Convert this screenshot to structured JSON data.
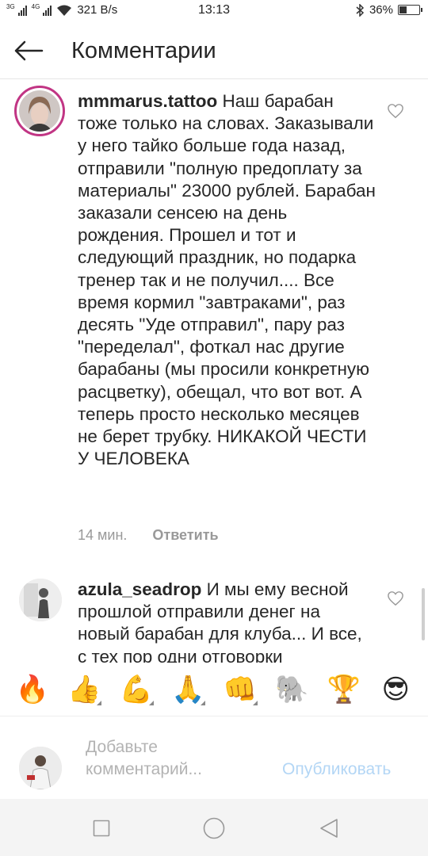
{
  "status_bar": {
    "network": "3G",
    "network2": "4G",
    "speed": "321 B/s",
    "time": "13:13",
    "battery": "36%",
    "battery_level": 0.36
  },
  "header": {
    "title": "Комментарии",
    "back_icon": "arrow-left-icon"
  },
  "comments": [
    {
      "username": "mmmarus.tattoo",
      "text": "Наш барабан тоже только на словах. Заказывали у него тайко больше года назад, отправили \"полную предоплату за материалы\" 23000 рублей. Барабан заказали сенсею на день рождения. Прошел и тот и следующий праздник, но подарка тренер так и не получил.... Все время кормил \"завтраками\", раз десять \"Уде отправил\", пару раз \"переделал\", фоткал нас другие барабаны (мы просили конкретную расцветку), обещал, что вот вот. А теперь просто несколько месяцев не берет трубку. НИКАКОЙ ЧЕСТИ У ЧЕЛОВЕКА",
      "time": "14 мин.",
      "reply": "Ответить"
    },
    {
      "username": "azula_seadrop",
      "text": "И мы ему весной прошлой отправили денег на новый барабан для клуба... И все, с тех пор одни отговорки"
    }
  ],
  "emoji_bar": [
    "🔥",
    "👍",
    "💪",
    "🙏",
    "👊",
    "🐘",
    "🏆",
    "😎"
  ],
  "composer": {
    "placeholder": "Добавьте комментарий...",
    "publish": "Опубликовать"
  },
  "colors": {
    "story_ring": "#c13584",
    "publish_disabled": "#b3d6f5",
    "meta_gray": "#999999"
  }
}
